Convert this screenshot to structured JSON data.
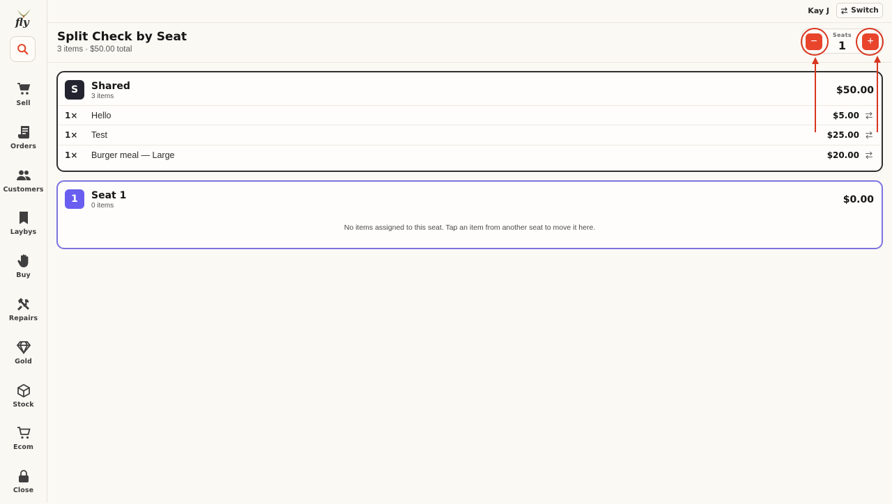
{
  "app": {
    "brand": "fly"
  },
  "topbar": {
    "user_name": "Kay J",
    "switch_label": "Switch"
  },
  "sidebar": {
    "items": [
      {
        "id": "sell",
        "label": "Sell",
        "icon": "cart-icon"
      },
      {
        "id": "orders",
        "label": "Orders",
        "icon": "receipt-icon"
      },
      {
        "id": "customers",
        "label": "Customers",
        "icon": "users-icon"
      },
      {
        "id": "laybys",
        "label": "Laybys",
        "icon": "bookmark-icon"
      },
      {
        "id": "buy",
        "label": "Buy",
        "icon": "hand-icon"
      },
      {
        "id": "repairs",
        "label": "Repairs",
        "icon": "tools-icon"
      },
      {
        "id": "gold",
        "label": "Gold",
        "icon": "diamond-icon"
      },
      {
        "id": "stock",
        "label": "Stock",
        "icon": "box-icon"
      },
      {
        "id": "ecom",
        "label": "Ecom",
        "icon": "shopping-cart-icon"
      },
      {
        "id": "close",
        "label": "Close",
        "icon": "lock-icon"
      }
    ]
  },
  "header": {
    "title": "Split Check by Seat",
    "subtitle": "3 items · $50.00 total",
    "seats_label": "Seats",
    "seats_count": "1",
    "minus_symbol": "−",
    "plus_symbol": "+"
  },
  "shared": {
    "avatar": "S",
    "name": "Shared",
    "count": "3 items",
    "total": "$50.00",
    "items": [
      {
        "qty": "1×",
        "name": "Hello",
        "price": "$5.00"
      },
      {
        "qty": "1×",
        "name": "Test",
        "price": "$25.00"
      },
      {
        "qty": "1×",
        "name": "Burger meal — Large",
        "price": "$20.00"
      }
    ]
  },
  "seat1": {
    "avatar": "1",
    "name": "Seat 1",
    "count": "0 items",
    "total": "$0.00",
    "empty_message": "No items assigned to this seat. Tap an item from another seat to move it here."
  },
  "colors": {
    "accent": "#e8452c",
    "seat_accent": "#6a5ef0",
    "shared_avatar": "#23242f",
    "annotation": "#d8361f"
  }
}
